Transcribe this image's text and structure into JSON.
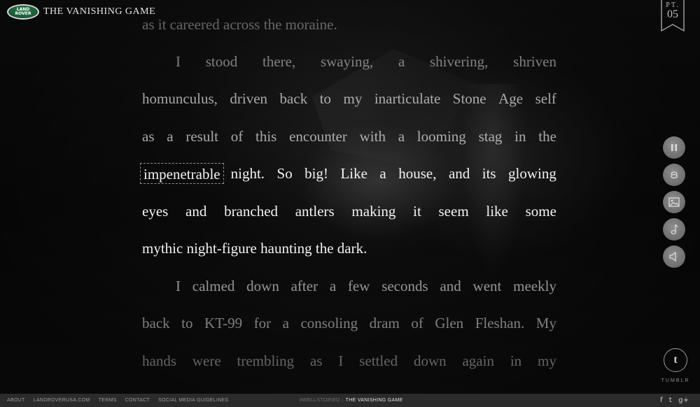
{
  "header": {
    "logo_line1": "LAND",
    "logo_line2": "ROVER",
    "title": "THE VANISHING GAME"
  },
  "chapter": {
    "label": "PT.",
    "number": "05"
  },
  "story": {
    "lines": [
      "as it careered across the moraine.",
      "I stood there, swaying, a shivering, shriven",
      "homunculus, driven back to my inarticulate Stone Age self",
      "as a result of this encounter with a looming stag in the",
      "night. So big! Like a house, and its glowing",
      "eyes and branched antlers making it seem like some",
      "mythic night-figure haunting the dark.",
      "I calmed down after a few seconds and went meekly",
      "back to KT-99 for a consoling dram of Glen Fleshan. My",
      "hands were trembling as I settled down again in my"
    ],
    "highlighted_word": "impenetrable"
  },
  "side_controls": [
    {
      "name": "pause",
      "icon": "pause-icon"
    },
    {
      "name": "glossary",
      "icon": "a-icon"
    },
    {
      "name": "images",
      "icon": "image-icon"
    },
    {
      "name": "music",
      "icon": "music-note-icon"
    },
    {
      "name": "sound",
      "icon": "speaker-icon"
    }
  ],
  "tumblr": {
    "glyph": "t",
    "label": "TUMBLR"
  },
  "footer": {
    "links": [
      "ABOUT",
      "LANDROVERUSA.COM",
      "TERMS",
      "CONTACT",
      "SOCIAL MEDIA GUIDELINES"
    ],
    "hashtag": "#WELLSTORIED",
    "separator": "|",
    "current": "THE VANISHING GAME",
    "social": [
      "f",
      "t",
      "g+"
    ]
  }
}
